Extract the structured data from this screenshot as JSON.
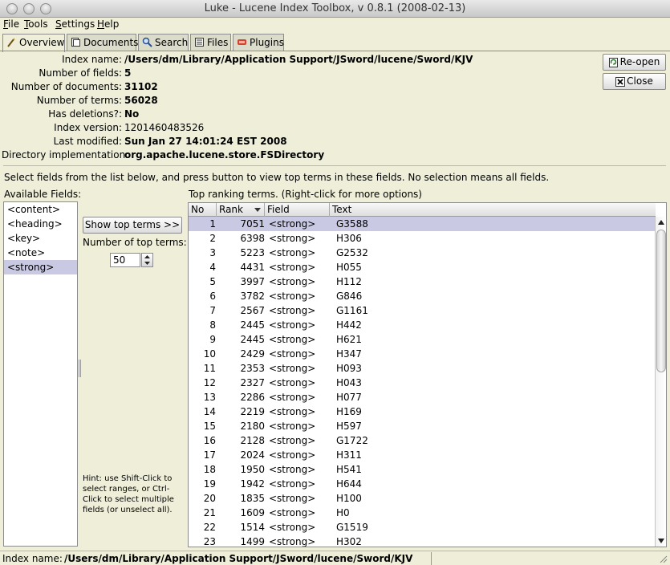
{
  "window": {
    "title": "Luke - Lucene Index Toolbox, v 0.8.1 (2008-02-13)"
  },
  "menu": [
    "File",
    "Tools",
    "Settings",
    "Help"
  ],
  "tabs": [
    {
      "label": "Overview",
      "icon": "wand-icon"
    },
    {
      "label": "Documents",
      "icon": "documents-icon"
    },
    {
      "label": "Search",
      "icon": "search-icon"
    },
    {
      "label": "Files",
      "icon": "files-icon"
    },
    {
      "label": "Plugins",
      "icon": "plugins-icon"
    }
  ],
  "overview": {
    "index_name_label": "Index name:",
    "index_name": "/Users/dm/Library/Application Support/JSword/lucene/Sword/KJV",
    "num_fields_label": "Number of fields:",
    "num_fields": "5",
    "num_docs_label": "Number of documents:",
    "num_docs": "31102",
    "num_terms_label": "Number of terms:",
    "num_terms": "56028",
    "deletions_label": "Has deletions?:",
    "deletions": "No",
    "version_label": "Index version:",
    "version": "1201460483526",
    "modified_label": "Last modified:",
    "modified": "Sun Jan 27 14:01:24 EST 2008",
    "dir_label": "Directory implementation:",
    "dir": "org.apache.lucene.store.FSDirectory"
  },
  "buttons": {
    "reopen": "Re-open",
    "close": "Close",
    "show_top_terms": "Show top terms >>"
  },
  "instructions": "Select fields from the list below, and press button to view top terms in these fields. No selection means all fields.",
  "available_fields_label": "Available Fields:",
  "fields": [
    "<content>",
    "<heading>",
    "<key>",
    "<note>",
    "<strong>"
  ],
  "num_top_terms_label": "Number of top terms:",
  "num_top_terms": "50",
  "hint": "Hint: use Shift-Click to select ranges, or Ctrl-Click to select multiple fields (or unselect all).",
  "top_terms_label": "Top ranking terms. (Right-click for more options)",
  "table": {
    "columns": [
      "No",
      "Rank",
      "Field",
      "Text"
    ],
    "rows": [
      [
        "1",
        "7051",
        "<strong>",
        "G3588"
      ],
      [
        "2",
        "6398",
        "<strong>",
        "H306"
      ],
      [
        "3",
        "5223",
        "<strong>",
        "G2532"
      ],
      [
        "4",
        "4431",
        "<strong>",
        "H055"
      ],
      [
        "5",
        "3997",
        "<strong>",
        "H112"
      ],
      [
        "6",
        "3782",
        "<strong>",
        "G846"
      ],
      [
        "7",
        "2567",
        "<strong>",
        "G1161"
      ],
      [
        "8",
        "2445",
        "<strong>",
        "H442"
      ],
      [
        "9",
        "2445",
        "<strong>",
        "H621"
      ],
      [
        "10",
        "2429",
        "<strong>",
        "H347"
      ],
      [
        "11",
        "2353",
        "<strong>",
        "H093"
      ],
      [
        "12",
        "2327",
        "<strong>",
        "H043"
      ],
      [
        "13",
        "2286",
        "<strong>",
        "H077"
      ],
      [
        "14",
        "2219",
        "<strong>",
        "H169"
      ],
      [
        "15",
        "2180",
        "<strong>",
        "H597"
      ],
      [
        "16",
        "2128",
        "<strong>",
        "G1722"
      ],
      [
        "17",
        "2024",
        "<strong>",
        "H311"
      ],
      [
        "18",
        "1950",
        "<strong>",
        "H541"
      ],
      [
        "19",
        "1942",
        "<strong>",
        "H644"
      ],
      [
        "20",
        "1835",
        "<strong>",
        "H100"
      ],
      [
        "21",
        "1609",
        "<strong>",
        "H0"
      ],
      [
        "22",
        "1514",
        "<strong>",
        "G1519"
      ],
      [
        "23",
        "1499",
        "<strong>",
        "H302"
      ]
    ]
  },
  "status": {
    "label": "Index name:",
    "value": "/Users/dm/Library/Application Support/JSword/lucene/Sword/KJV"
  }
}
